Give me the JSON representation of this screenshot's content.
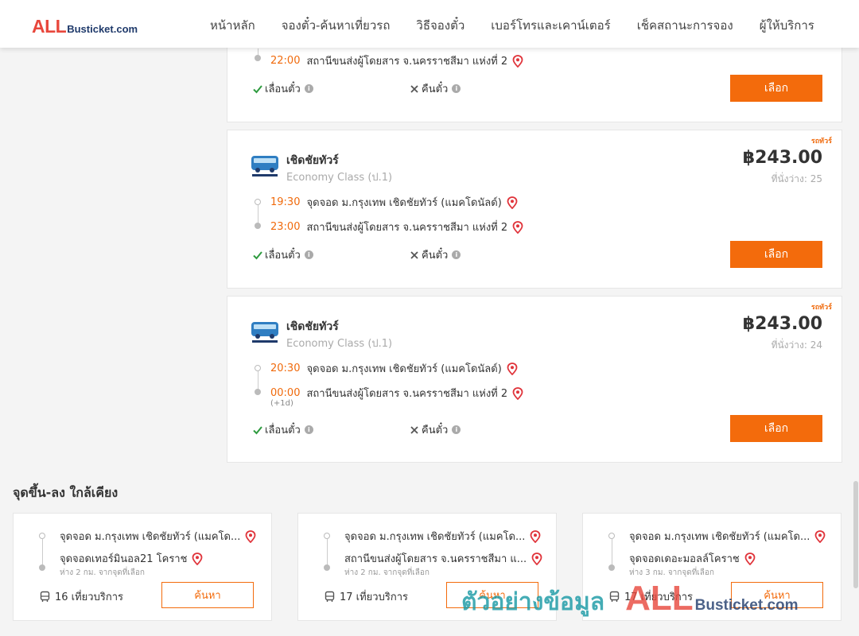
{
  "header": {
    "logo_main": "ALL",
    "logo_rest": "Busticket.com",
    "nav": [
      "หน้าหลัก",
      "จองตั๋ว-ค้นหาเที่ยวรถ",
      "วิธีจองตั๋ว",
      "เบอร์โทรและเคาน์เตอร์",
      "เช็คสถานะการจอง",
      "ผู้ให้บริการ"
    ]
  },
  "trips": [
    {
      "arrive_time": "22:00",
      "arrive_place": "สถานีขนส่งผู้โดยสาร จ.นครราชสีมา แห่งที่ 2",
      "reschedule": "เลื่อนตั๋ว",
      "refund": "คืนตั๋ว",
      "select_label": "เลือก"
    },
    {
      "tag": "รถทัวร์",
      "operator": "เชิดชัยทัวร์",
      "class": "Economy Class (ป.1)",
      "price": "฿243.00",
      "seats": "ที่นั่งว่าง: 25",
      "depart_time": "19:30",
      "depart_place": "จุดจอด ม.กรุงเทพ เชิดชัยทัวร์ (แมคโดนัลด์)",
      "arrive_time": "23:00",
      "arrive_place": "สถานีขนส่งผู้โดยสาร จ.นครราชสีมา แห่งที่ 2",
      "reschedule": "เลื่อนตั๋ว",
      "refund": "คืนตั๋ว",
      "select_label": "เลือก"
    },
    {
      "tag": "รถทัวร์",
      "operator": "เชิดชัยทัวร์",
      "class": "Economy Class (ป.1)",
      "price": "฿243.00",
      "seats": "ที่นั่งว่าง: 24",
      "depart_time": "20:30",
      "depart_place": "จุดจอด ม.กรุงเทพ เชิดชัยทัวร์ (แมคโดนัลด์)",
      "arrive_time": "00:00",
      "arrive_next_day": "(+1d)",
      "arrive_place": "สถานีขนส่งผู้โดยสาร จ.นครราชสีมา แห่งที่ 2",
      "reschedule": "เลื่อนตั๋ว",
      "refund": "คืนตั๋ว",
      "select_label": "เลือก"
    }
  ],
  "nearby": {
    "title": "จุดขึ้น-ลง ใกล้เคียง",
    "cards": [
      {
        "from": "จุดจอด ม.กรุงเทพ เชิดชัยทัวร์ (แมคโด...",
        "to": "จุดจอดเทอร์มินอล21 โคราช",
        "distance": "ห่าง 2 กม. จากจุดที่เลือก",
        "service": "16 เที่ยวบริการ",
        "search_label": "ค้นหา"
      },
      {
        "from": "จุดจอด ม.กรุงเทพ เชิดชัยทัวร์ (แมคโด...",
        "to": "สถานีขนส่งผู้โดยสาร จ.นครราชสีมา แ...",
        "distance": "ห่าง 2 กม. จากจุดที่เลือก",
        "service": "17 เที่ยวบริการ",
        "search_label": "ค้นหา"
      },
      {
        "from": "จุดจอด ม.กรุงเทพ เชิดชัยทัวร์ (แมคโด...",
        "to": "จุดจอดเดอะมอลล์โคราช",
        "distance": "ห่าง 3 กม. จากจุดที่เลือก",
        "service": "17 เที่ยวบริการ",
        "search_label": "ค้นหา"
      }
    ]
  },
  "watermark": {
    "thai": "ตัวอย่างข้อมูล",
    "main": "ALL",
    "rest": "Busticket.com"
  },
  "colors": {
    "accent": "#f36b0c",
    "brand_red": "#e8473c",
    "brand_navy": "#1f3a6b",
    "check_green": "#2e9b3f",
    "pin_red": "#e0343b"
  }
}
